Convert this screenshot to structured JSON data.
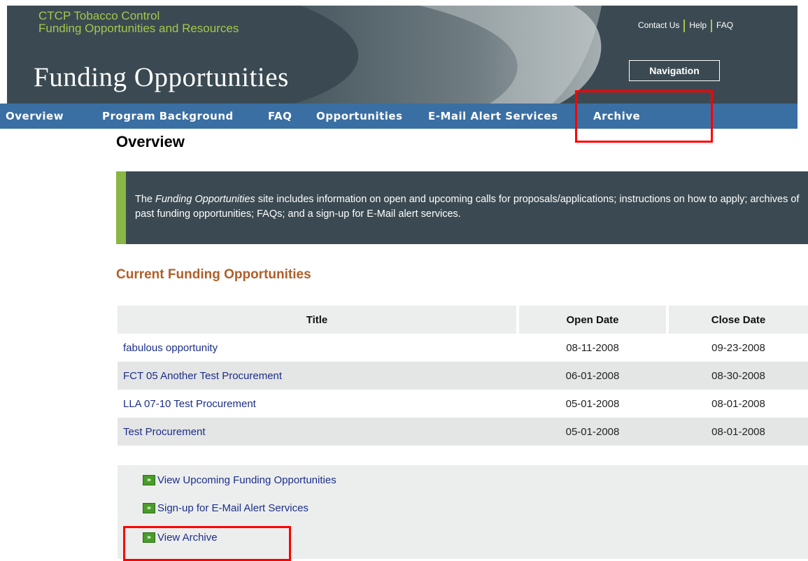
{
  "header": {
    "title_line1": "CTCP Tobacco Control",
    "title_line2": "Funding Opportunities and Resources",
    "banner": "Funding Opportunities",
    "utility_links": [
      "Contact Us",
      "Help",
      "FAQ"
    ],
    "nav_button": "Navigation"
  },
  "nav": {
    "items": [
      "Overview",
      "Program Background",
      "FAQ",
      "Opportunities",
      "E-Mail Alert Services",
      "Archive"
    ]
  },
  "content": {
    "title": "Overview",
    "intro_prefix": "The ",
    "intro_em": "Funding Opportunities",
    "intro_rest": " site includes information on open and upcoming calls for proposals/applications; instructions on how to apply; archives of past funding opportunities; FAQs; and a sign-up for E-Mail alert services.",
    "current_heading": "Current Funding Opportunities"
  },
  "table": {
    "headers": [
      "Title",
      "Open Date",
      "Close Date"
    ],
    "rows": [
      {
        "title": "fabulous opportunity",
        "open": "08-11-2008",
        "close": "09-23-2008"
      },
      {
        "title": "FCT 05 Another Test Procurement",
        "open": "06-01-2008",
        "close": "08-30-2008"
      },
      {
        "title": "LLA 07-10 Test Procurement",
        "open": "05-01-2008",
        "close": "08-01-2008"
      },
      {
        "title": "Test Procurement",
        "open": "05-01-2008",
        "close": "08-01-2008"
      }
    ]
  },
  "links": {
    "items": [
      "View Upcoming Funding Opportunities",
      "Sign-up for E-Mail Alert Services",
      "View Archive"
    ],
    "icon": "double-arrow-icon"
  },
  "colors": {
    "header_bg": "#3b4a52",
    "accent_green": "#a4c84b",
    "nav_bg": "#3a6fa3",
    "heading_orange": "#b15e28",
    "link_blue": "#1c2e8a",
    "highlight_red": "#ff0000"
  }
}
